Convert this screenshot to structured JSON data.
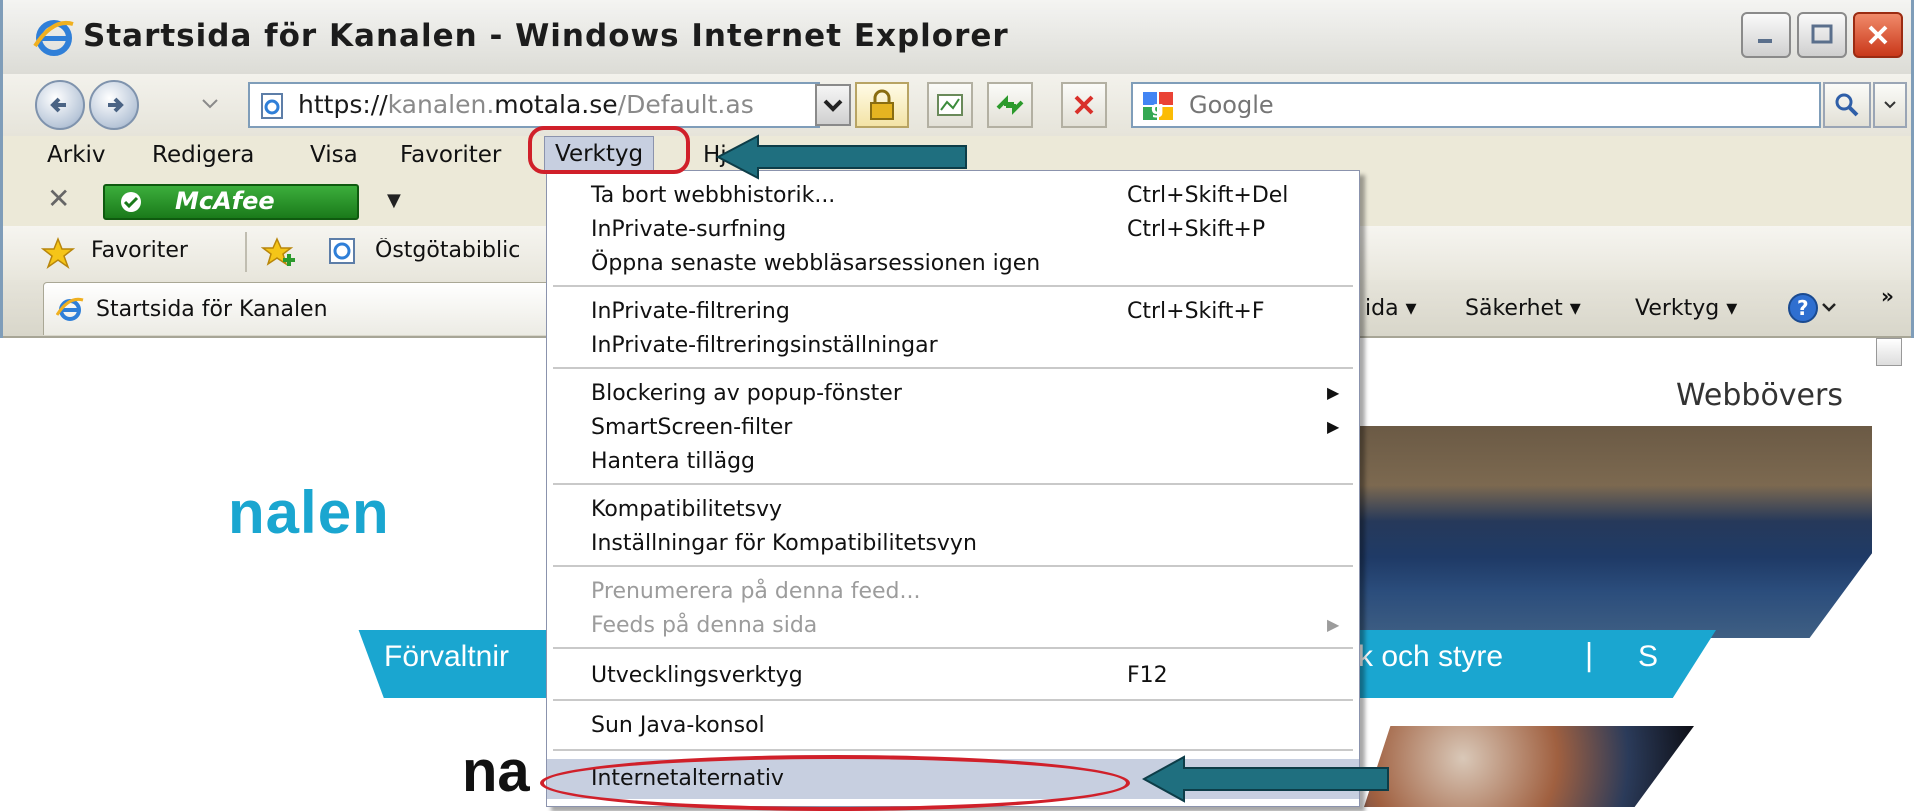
{
  "window": {
    "title": "Startsida för Kanalen - Windows Internet Explorer"
  },
  "address_bar": {
    "url_prefix": "https://",
    "url_host_dim1": "kanalen.",
    "url_host_bold": "motala.se",
    "url_path": "/Default.as"
  },
  "search": {
    "placeholder": "Google"
  },
  "menubar": {
    "items": [
      "Arkiv",
      "Redigera",
      "Visa",
      "Favoriter",
      "Verktyg",
      "Hj"
    ]
  },
  "mcafee": {
    "label": "McAfee"
  },
  "favorites_bar": {
    "favorites_label": "Favoriter",
    "link_label": "Östgötabiblic"
  },
  "tab": {
    "label": "Startsida för Kanalen"
  },
  "command_bar": {
    "sida": "ida ▾",
    "sakerhet": "Säkerhet ▾",
    "verktyg": "Verktyg ▾",
    "more": "»"
  },
  "tools_menu": {
    "items": [
      {
        "label": "Ta bort webbhistorik...",
        "shortcut": "Ctrl+Skift+Del"
      },
      {
        "label": "InPrivate-surfning",
        "shortcut": "Ctrl+Skift+P"
      },
      {
        "label": "Öppna senaste webbläsarsessionen igen",
        "shortcut": ""
      },
      {
        "label": "InPrivate-filtrering",
        "shortcut": "Ctrl+Skift+F"
      },
      {
        "label": "InPrivate-filtreringsinställningar",
        "shortcut": ""
      },
      {
        "label": "Blockering av popup-fönster",
        "shortcut": "",
        "submenu": true
      },
      {
        "label": "SmartScreen-filter",
        "shortcut": "",
        "submenu": true
      },
      {
        "label": "Hantera tillägg",
        "shortcut": ""
      },
      {
        "label": "Kompatibilitetsvy",
        "shortcut": ""
      },
      {
        "label": "Inställningar för Kompatibilitetsvyn",
        "shortcut": ""
      },
      {
        "label": "Prenumerera på denna feed...",
        "shortcut": "",
        "disabled": true
      },
      {
        "label": "Feeds på denna sida",
        "shortcut": "",
        "disabled": true,
        "submenu": true
      },
      {
        "label": "Utvecklingsverktyg",
        "shortcut": "F12"
      },
      {
        "label": "Sun Java-konsol",
        "shortcut": ""
      },
      {
        "label": "Internetalternativ",
        "shortcut": "",
        "highlighted": true
      }
    ]
  },
  "page": {
    "webboversattning": "Webbövers",
    "logo_text": "nalen",
    "nav_forvaltning": "Förvaltnir",
    "nav_politik": "k och styre",
    "nav_divider": "|",
    "nav_s": "S",
    "heading_partial": "na"
  },
  "colors": {
    "highlight_red": "#d0202a",
    "arrow_teal": "#1f6f7f",
    "brand_cyan": "#1aa6d0",
    "menu_highlight": "#c7cfe0"
  }
}
